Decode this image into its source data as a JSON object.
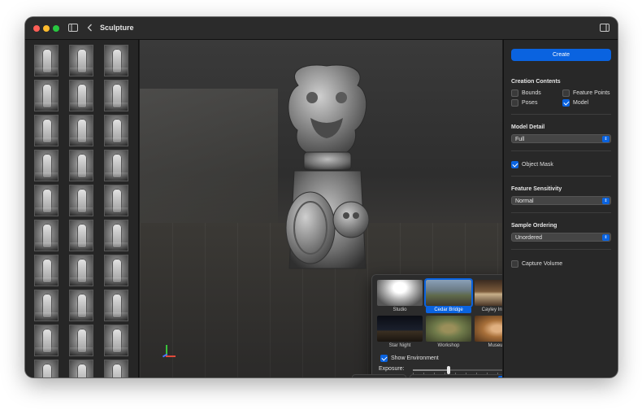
{
  "window": {
    "title": "Sculpture"
  },
  "thumbnails": {
    "count": 30
  },
  "environment": {
    "presets": [
      {
        "name": "Studio",
        "image": "studio",
        "selected": false
      },
      {
        "name": "Cedar Bridge",
        "image": "cedar",
        "selected": true
      },
      {
        "name": "Cayley Interior",
        "image": "cayley",
        "selected": false
      },
      {
        "name": "Star Night",
        "image": "star",
        "selected": false
      },
      {
        "name": "Workshop",
        "image": "workshop",
        "selected": false
      },
      {
        "name": "Museum",
        "image": "museum",
        "selected": false
      }
    ],
    "show_environment_label": "Show Environment",
    "show_environment_checked": true,
    "exposure_label": "Exposure:",
    "exposure_fraction": 0.34
  },
  "inspector": {
    "create_label": "Create",
    "creation_contents_title": "Creation Contents",
    "creation_contents": {
      "bounds": {
        "label": "Bounds",
        "checked": false
      },
      "feature_points": {
        "label": "Feature Points",
        "checked": false
      },
      "poses": {
        "label": "Poses",
        "checked": false
      },
      "model": {
        "label": "Model",
        "checked": true
      }
    },
    "model_detail_title": "Model Detail",
    "model_detail_value": "Full",
    "object_mask": {
      "label": "Object Mask",
      "checked": true
    },
    "feature_sensitivity_title": "Feature Sensitivity",
    "feature_sensitivity_value": "Normal",
    "sample_ordering_title": "Sample Ordering",
    "sample_ordering_value": "Unordered",
    "capture_volume": {
      "label": "Capture Volume",
      "checked": false
    }
  },
  "toolbar": {
    "group1": [
      "frame-icon",
      "bounds-icon",
      "points-icon",
      "camera-icon"
    ],
    "group2": [
      "grid-icon",
      "contrast-icon",
      "light-icon",
      "rectangle-icon",
      "cube-icon",
      "graph-icon",
      "dots-grid-icon",
      "environment-icon"
    ],
    "active": [
      "grid-icon",
      "environment-icon"
    ]
  },
  "colors": {
    "accent": "#0a63e0",
    "window_bg": "#1e1e1e",
    "inspector_bg": "#282828"
  }
}
